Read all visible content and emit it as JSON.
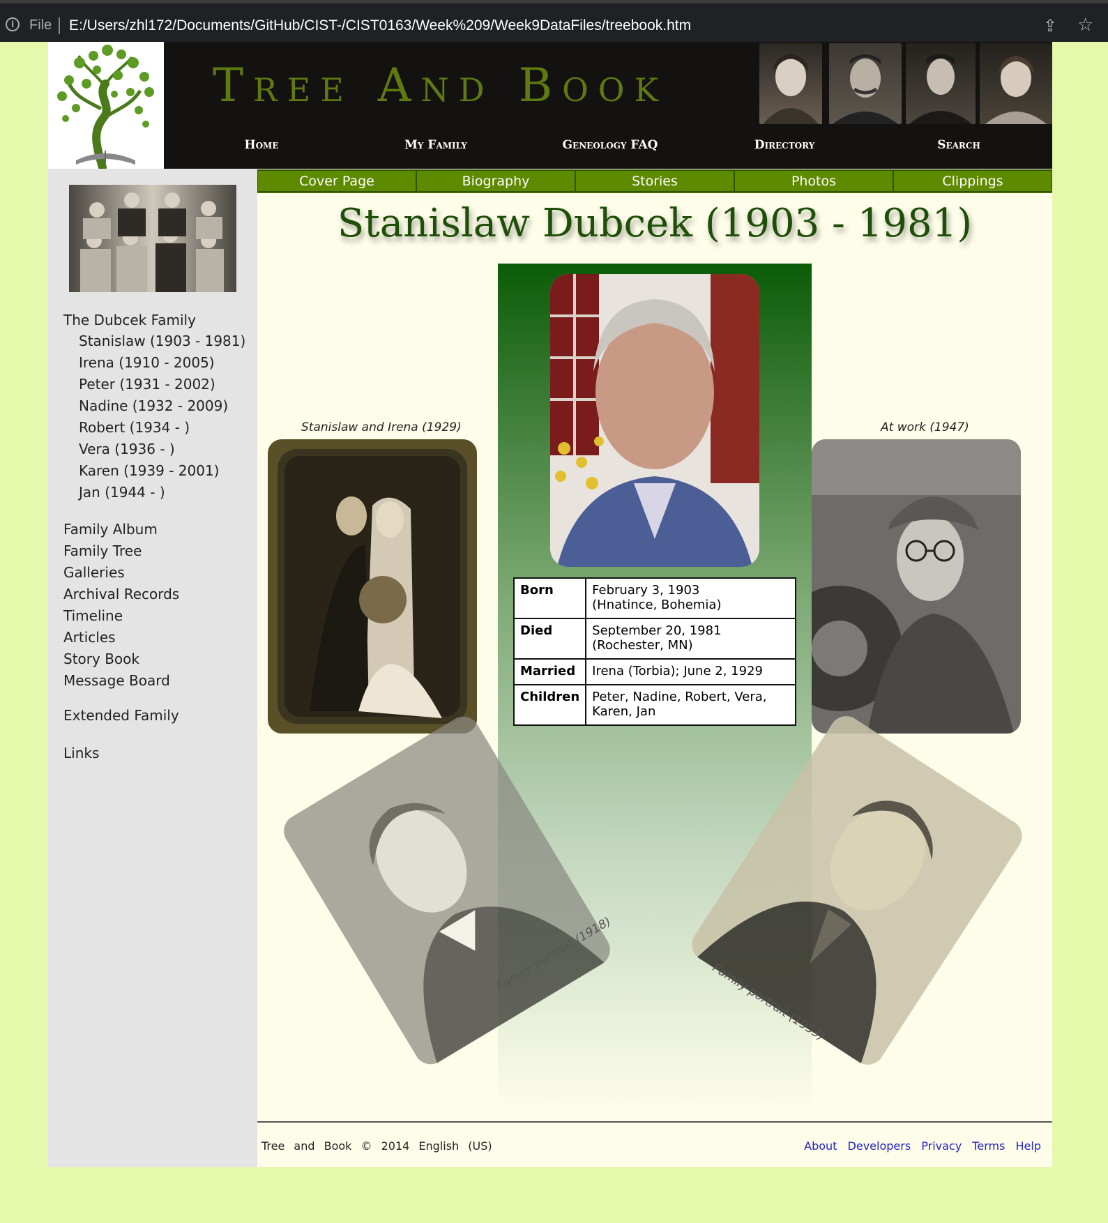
{
  "browser": {
    "scheme": "File",
    "url": "E:/Users/zhl172/Documents/GitHub/CIST-/CIST0163/Week%209/Week9DataFiles/treebook.htm"
  },
  "site": {
    "title": "Tree And Book",
    "nav": [
      "Home",
      "My Family",
      "Geneology FAQ",
      "Directory",
      "Search"
    ]
  },
  "sidebar": {
    "heading": "The Dubcek Family",
    "members": [
      "Stanislaw (1903 - 1981)",
      "Irena (1910 - 2005)",
      "Peter (1931 - 2002)",
      "Nadine (1932 - 2009)",
      "Robert (1934 - )",
      "Vera (1936 - )",
      "Karen (1939 - 2001)",
      "Jan (1944 - )"
    ],
    "links": [
      "Family Album",
      "Family Tree",
      "Galleries",
      "Archival Records",
      "Timeline",
      "Articles",
      "Story Book",
      "Message Board"
    ],
    "extended": "Extended Family",
    "links_label": "Links"
  },
  "subnav": [
    "Cover Page",
    "Biography",
    "Stories",
    "Photos",
    "Clippings"
  ],
  "main": {
    "title": "Stanislaw Dubcek (1903 - 1981)",
    "facts": [
      {
        "label": "Born",
        "value_line1": "February 3, 1903",
        "value_line2": "(Hnatince, Bohemia)"
      },
      {
        "label": "Died",
        "value_line1": "September 20, 1981",
        "value_line2": "(Rochester, MN)"
      },
      {
        "label": "Married",
        "value_line1": "Irena (Torbia); June 2, 1929",
        "value_line2": ""
      },
      {
        "label": "Children",
        "value_line1": "Peter, Nadine, Robert, Vera,",
        "value_line2": "Karen, Jan"
      }
    ],
    "captions": {
      "left": "Stanislaw and Irena (1929)",
      "right": "At work (1947)",
      "tilt_left": "Family portrait (1918)",
      "tilt_right": "Family portrait (1953)"
    }
  },
  "footer": {
    "left": "Tree and Book © 2014 English (US)",
    "links": [
      "About",
      "Developers",
      "Privacy",
      "Terms",
      "Help"
    ]
  }
}
